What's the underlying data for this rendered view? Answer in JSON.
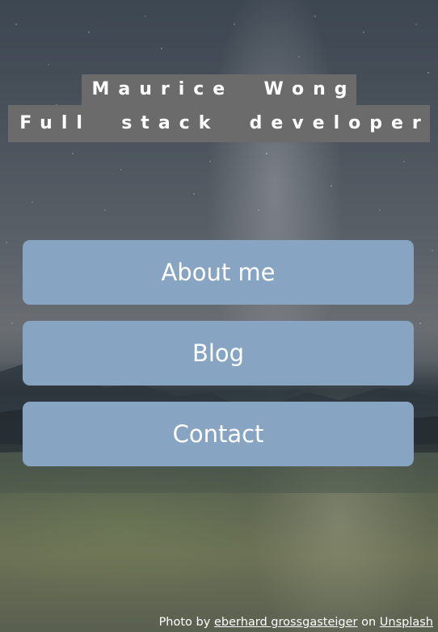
{
  "header": {
    "name": "Maurice  Wong",
    "role": "Full  stack  developer"
  },
  "nav": {
    "items": [
      {
        "label": "About me"
      },
      {
        "label": "Blog"
      },
      {
        "label": "Contact"
      }
    ]
  },
  "credit": {
    "prefix": "Photo by",
    "photographer": "eberhard grossgasteiger",
    "middle": "on",
    "site": "Unsplash"
  },
  "colors": {
    "button_background": "#87a5c2",
    "title_background": "#6b6b6b",
    "text": "#ffffff"
  }
}
